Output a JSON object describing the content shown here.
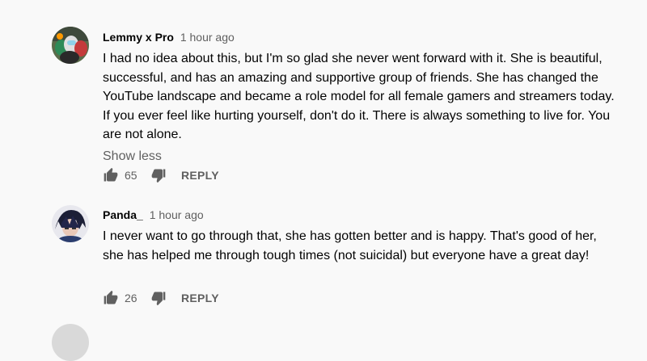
{
  "comments": [
    {
      "author": "Lemmy x Pro",
      "time": "1 hour ago",
      "text": "I had no idea about this, but I'm so glad she never went forward with it. She is beautiful, successful, and has an amazing and supportive group of friends. She has changed the YouTube landscape and became a role model for all female gamers and streamers today. If you ever feel like hurting yourself, don't do it. There is always something to live for. You are not alone.",
      "show_less": "Show less",
      "likes": "65",
      "reply": "REPLY",
      "avatar_icon": "among-us-avatar-icon"
    },
    {
      "author": "Panda_",
      "time": "1 hour ago",
      "text": "I never want to go through that, she has gotten better and is happy. That's good of her, she has helped me through tough times (not suicidal) but everyone have a great day!",
      "likes": "26",
      "reply": "REPLY",
      "avatar_icon": "anime-avatar-icon"
    }
  ],
  "colors": {
    "background": "#f9f9f9",
    "text": "#030303",
    "secondary": "#606060"
  }
}
